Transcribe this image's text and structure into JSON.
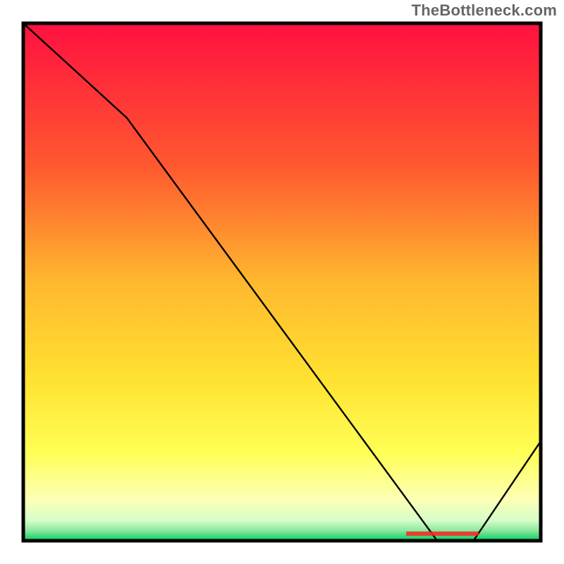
{
  "watermark": "TheBottleneck.com",
  "annotation_label": "",
  "chart_data": {
    "type": "line",
    "title": "",
    "xlabel": "",
    "ylabel": "",
    "x": [
      0,
      20,
      80,
      87,
      100
    ],
    "values": [
      104,
      85,
      0,
      0,
      20
    ],
    "xlim": [
      0,
      100
    ],
    "ylim": [
      0,
      104
    ],
    "grid": false,
    "legend": false,
    "background_gradient": {
      "top_color": "#ff1040",
      "upper_mid_color": "#ff8a2a",
      "mid_color": "#ffe030",
      "lower_mid_color": "#ffff60",
      "near_bottom_color": "#fbffb8",
      "bottom_color": "#00d060"
    },
    "annotations": [
      {
        "text": "",
        "x_start": 74,
        "x_end": 88,
        "y": 1
      }
    ]
  }
}
